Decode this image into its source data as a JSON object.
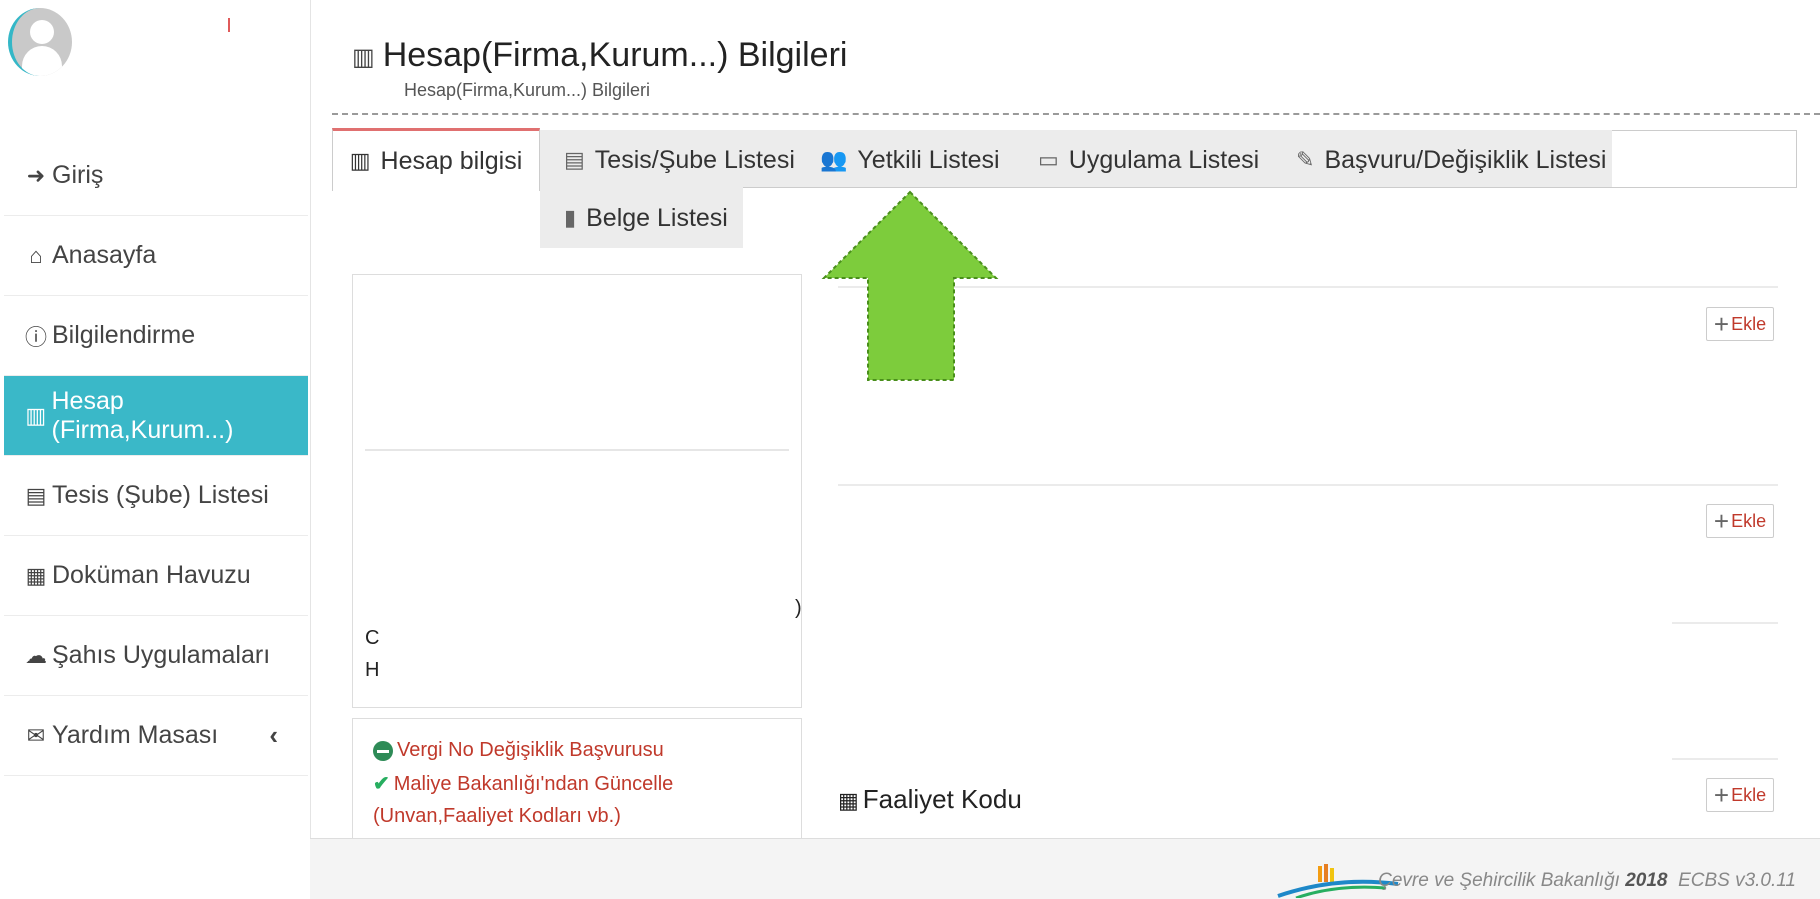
{
  "sidebar": {
    "items": [
      {
        "label": "Giriş",
        "icon": "sign-in-icon"
      },
      {
        "label": "Anasayfa",
        "icon": "home-icon"
      },
      {
        "label": "Bilgilendirme",
        "icon": "info-icon"
      },
      {
        "label": "Hesap (Firma,Kurum...)",
        "icon": "building-icon",
        "active": true
      },
      {
        "label": "Tesis (Şube) Listesi",
        "icon": "clipboard-icon"
      },
      {
        "label": "Doküman Havuzu",
        "icon": "box-icon"
      },
      {
        "label": "Şahıs Uygulamaları",
        "icon": "cloud-icon"
      },
      {
        "label": "Yardım Masası",
        "icon": "envelope-icon",
        "chevron": "‹"
      }
    ]
  },
  "header": {
    "title": "Hesap(Firma,Kurum...) Bilgileri",
    "subtitle": "Hesap(Firma,Kurum...) Bilgileri"
  },
  "tabs": [
    {
      "label": "Hesap bilgisi",
      "icon": "building-icon",
      "active": true
    },
    {
      "label": "Tesis/Şube Listesi",
      "icon": "clipboard-icon"
    },
    {
      "label": "Yetkili Listesi",
      "icon": "users-icon"
    },
    {
      "label": "Uygulama Listesi",
      "icon": "laptop-icon"
    },
    {
      "label": "Başvuru/Değişiklik Listesi",
      "icon": "edit-icon"
    },
    {
      "label": "Belge Listesi",
      "icon": "file-icon"
    }
  ],
  "left_card": {
    "fragments": [
      "C",
      "H",
      ")"
    ]
  },
  "actions": {
    "vergi": "Vergi No Değişiklik Başvurusu",
    "maliye": "Maliye Bakanlığı'ndan Güncelle",
    "maliye_note": "(Unvan,Faaliyet Kodları vb.)"
  },
  "sections": {
    "add_label": "Ekle",
    "faaliyet_title": "Faaliyet Kodu"
  },
  "footer": {
    "ministry": "Çevre ve Şehircilik Bakanlığı",
    "year": "2018",
    "version": "ECBS v3.0.11"
  },
  "colors": {
    "accent": "#3ab8c8",
    "arrow": "#7dcc3c",
    "danger": "#c0392b",
    "tab_active_border": "#e07070"
  }
}
